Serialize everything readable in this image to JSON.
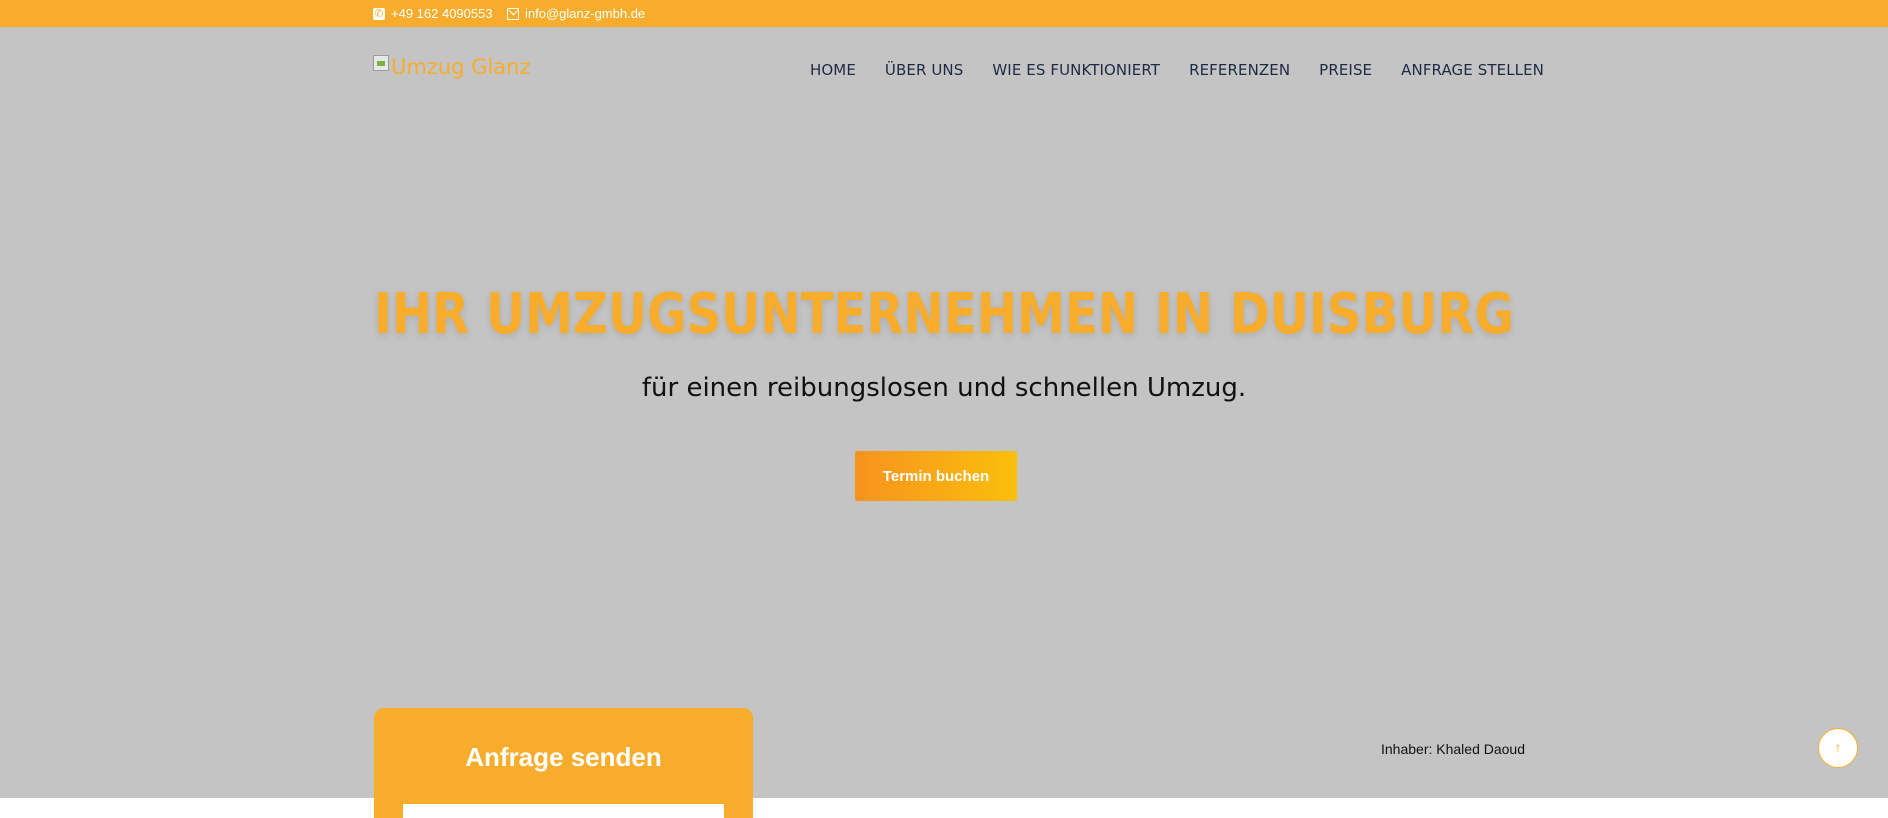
{
  "topbar": {
    "phone": "+49 162 4090553",
    "email": "info@glanz-gmbh.de",
    "phone_icon": "phone-icon",
    "email_icon": "envelope-icon",
    "color": "#f7ad2b"
  },
  "header": {
    "logo_alt": "Umzug Glanz",
    "nav": [
      "HOME",
      "ÜBER UNS",
      "WIE ES FUNKTIONIERT",
      "REFERENZEN",
      "PREISE",
      "ANFRAGE STELLEN"
    ]
  },
  "hero": {
    "title": "IHR UMZUGSUNTERNEHMEN IN DUISBURG",
    "subtitle": "für einen reibungslosen und schnellen Umzug.",
    "cta_label": "Termin buchen",
    "owner": "Inhaber: Khaled Daoud"
  },
  "form": {
    "heading": "Anfrage senden"
  },
  "scroll_top": {
    "icon": "arrow-up-icon",
    "glyph": "↑"
  },
  "colors": {
    "accent": "#f7ad2b",
    "hero_bg": "#c4c4c4",
    "nav_text": "#1e2a44"
  }
}
